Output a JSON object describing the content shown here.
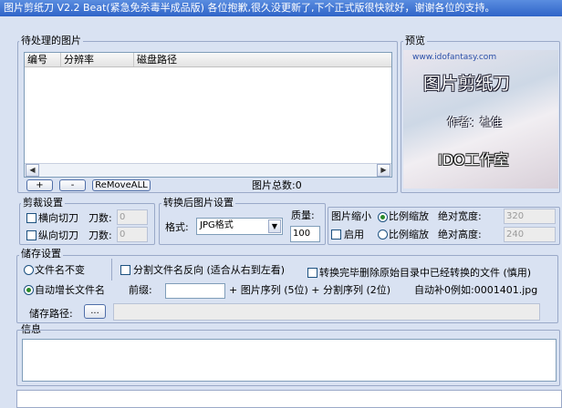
{
  "title": "图片剪纸刀 V2.2 Beat(紧急免杀毒半成品版) 各位抱歉,很久没更新了,下个正式版很快就好，谢谢各位的支持。",
  "pending": {
    "label": "待处理的图片",
    "columns": [
      "编号",
      "分辨率",
      "磁盘路径"
    ],
    "add_label": "+",
    "remove_label": "-",
    "remove_all_label": "ReMoveALL",
    "total_label": "图片总数:0"
  },
  "preview": {
    "label": "预览",
    "url_text": "www.idofantasy.com",
    "logo_text": "图片剪纸刀",
    "author_text": "作者：杜佳",
    "studio_text": "IDO工作室"
  },
  "cut": {
    "label": "剪裁设置",
    "horizontal_label": "横向切刀",
    "vertical_label": "纵向切刀",
    "knife_label_1": "刀数:",
    "knife_label_2": "刀数:",
    "horizontal_value": "0",
    "vertical_value": "0"
  },
  "convert": {
    "label": "转换后图片设置",
    "format_label": "格式:",
    "format_value": "JPG格式",
    "quality_label": "质量:",
    "quality_value": "100"
  },
  "scale": {
    "label": "图片缩小",
    "enable_label": "启用",
    "ratio_label_1": "比例缩放",
    "ratio_label_2": "比例缩放",
    "abs_width_label": "绝对宽度:",
    "abs_height_label": "绝对高度:",
    "width_value": "320",
    "height_value": "240"
  },
  "save": {
    "label": "储存设置",
    "filename_unchanged": "文件名不变",
    "split_reverse": "分割文件名反向 (适合从右到左看)",
    "delete_original": "转换完毕删除原始目录中已经转换的文件 (慎用)",
    "auto_increment": "自动增长文件名",
    "prefix_label": "前缀:",
    "prefix_value": "",
    "sequence_text": "+ 图片序列 (5位) + 分割序列 (2位)",
    "example_text": "自动补0例如:0001401.jpg",
    "path_label": "储存路径:",
    "browse_label": "...",
    "path_value": ""
  },
  "info": {
    "label": "信息",
    "content": ""
  }
}
